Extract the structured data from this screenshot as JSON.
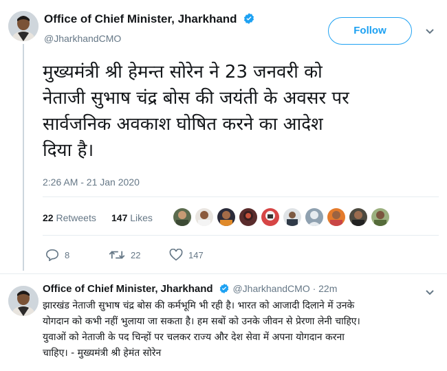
{
  "tweet": {
    "author_name": "Office of Chief Minister, Jharkhand",
    "handle": "@JharkhandCMO",
    "follow_label": "Follow",
    "text_lines": [
      "मुख्यमंत्री श्री हेमन्त सोरेन ने 23 जनवरी को",
      "नेताजी सुभाष चंद्र बोस की जयंती के अवसर पर",
      "सार्वजनिक अवकाश घोषित करने का आदेश",
      "दिया है।"
    ],
    "timestamp": "2:26 AM - 21 Jan 2020",
    "retweets_count": "22",
    "retweets_label": "Retweets",
    "likes_count": "147",
    "likes_label": "Likes",
    "actions": {
      "reply_count": "8",
      "retweet_count": "22",
      "like_count": "147"
    }
  },
  "reply": {
    "author_name": "Office of Chief Minister, Jharkhand",
    "handle_time": "@JharkhandCMO · 22m",
    "text_lines": [
      "झारखंड नेताजी सुभाष चंद्र बोस की कर्मभूमि भी रही है। भारत को आजादी दिलाने में उनके",
      "योगदान को कभी नहीं भुलाया जा सकता है। हम सबों को उनके जीवन से प्रेरणा लेनी चाहिए।",
      "युवाओं को नेताजी के पद चिन्हों पर चलकर राज्य और देश सेवा में अपना योगदान करना",
      "चाहिए। - मुख्यमंत्री श्री हेमंत सोरेन"
    ]
  },
  "colors": {
    "accent": "#1da1f2",
    "secondary_text": "#657786",
    "divider": "#e6ecf0"
  }
}
